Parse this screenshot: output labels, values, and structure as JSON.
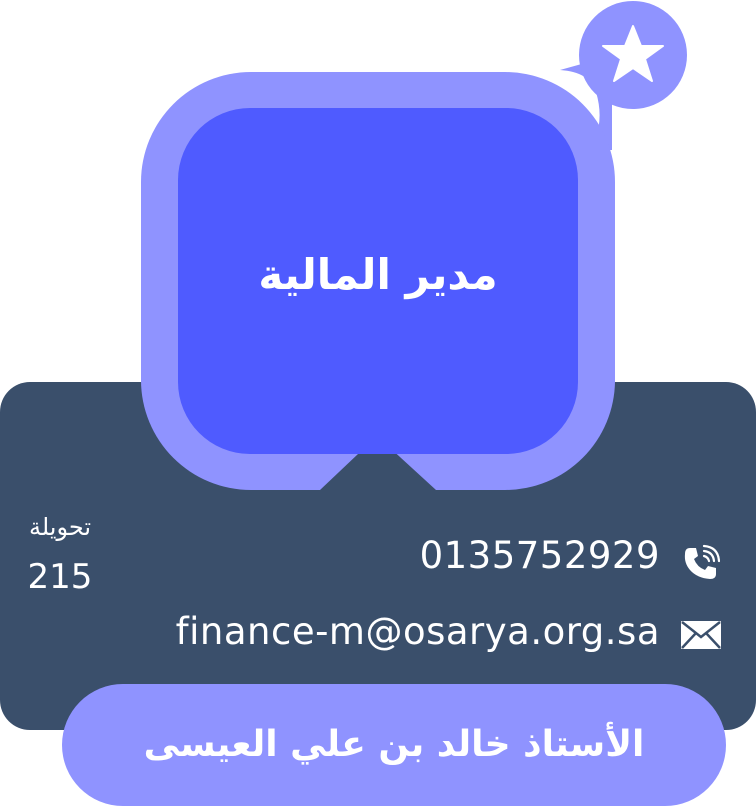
{
  "card": {
    "title": "مدير المالية",
    "extension_label": "تحويلة",
    "extension_number": "215",
    "phone": "0135752929",
    "email": "finance-m@osarya.org.sa",
    "name": "الأستاذ خالد بن علي العيسى"
  },
  "icons": {
    "badge": "star-icon",
    "phone": "phone-icon",
    "email": "envelope-icon"
  },
  "colors": {
    "panel": "#3a4f6b",
    "bubble_outer": "#8f93ff",
    "bubble_inner": "#4f5bff",
    "text": "#ffffff"
  }
}
